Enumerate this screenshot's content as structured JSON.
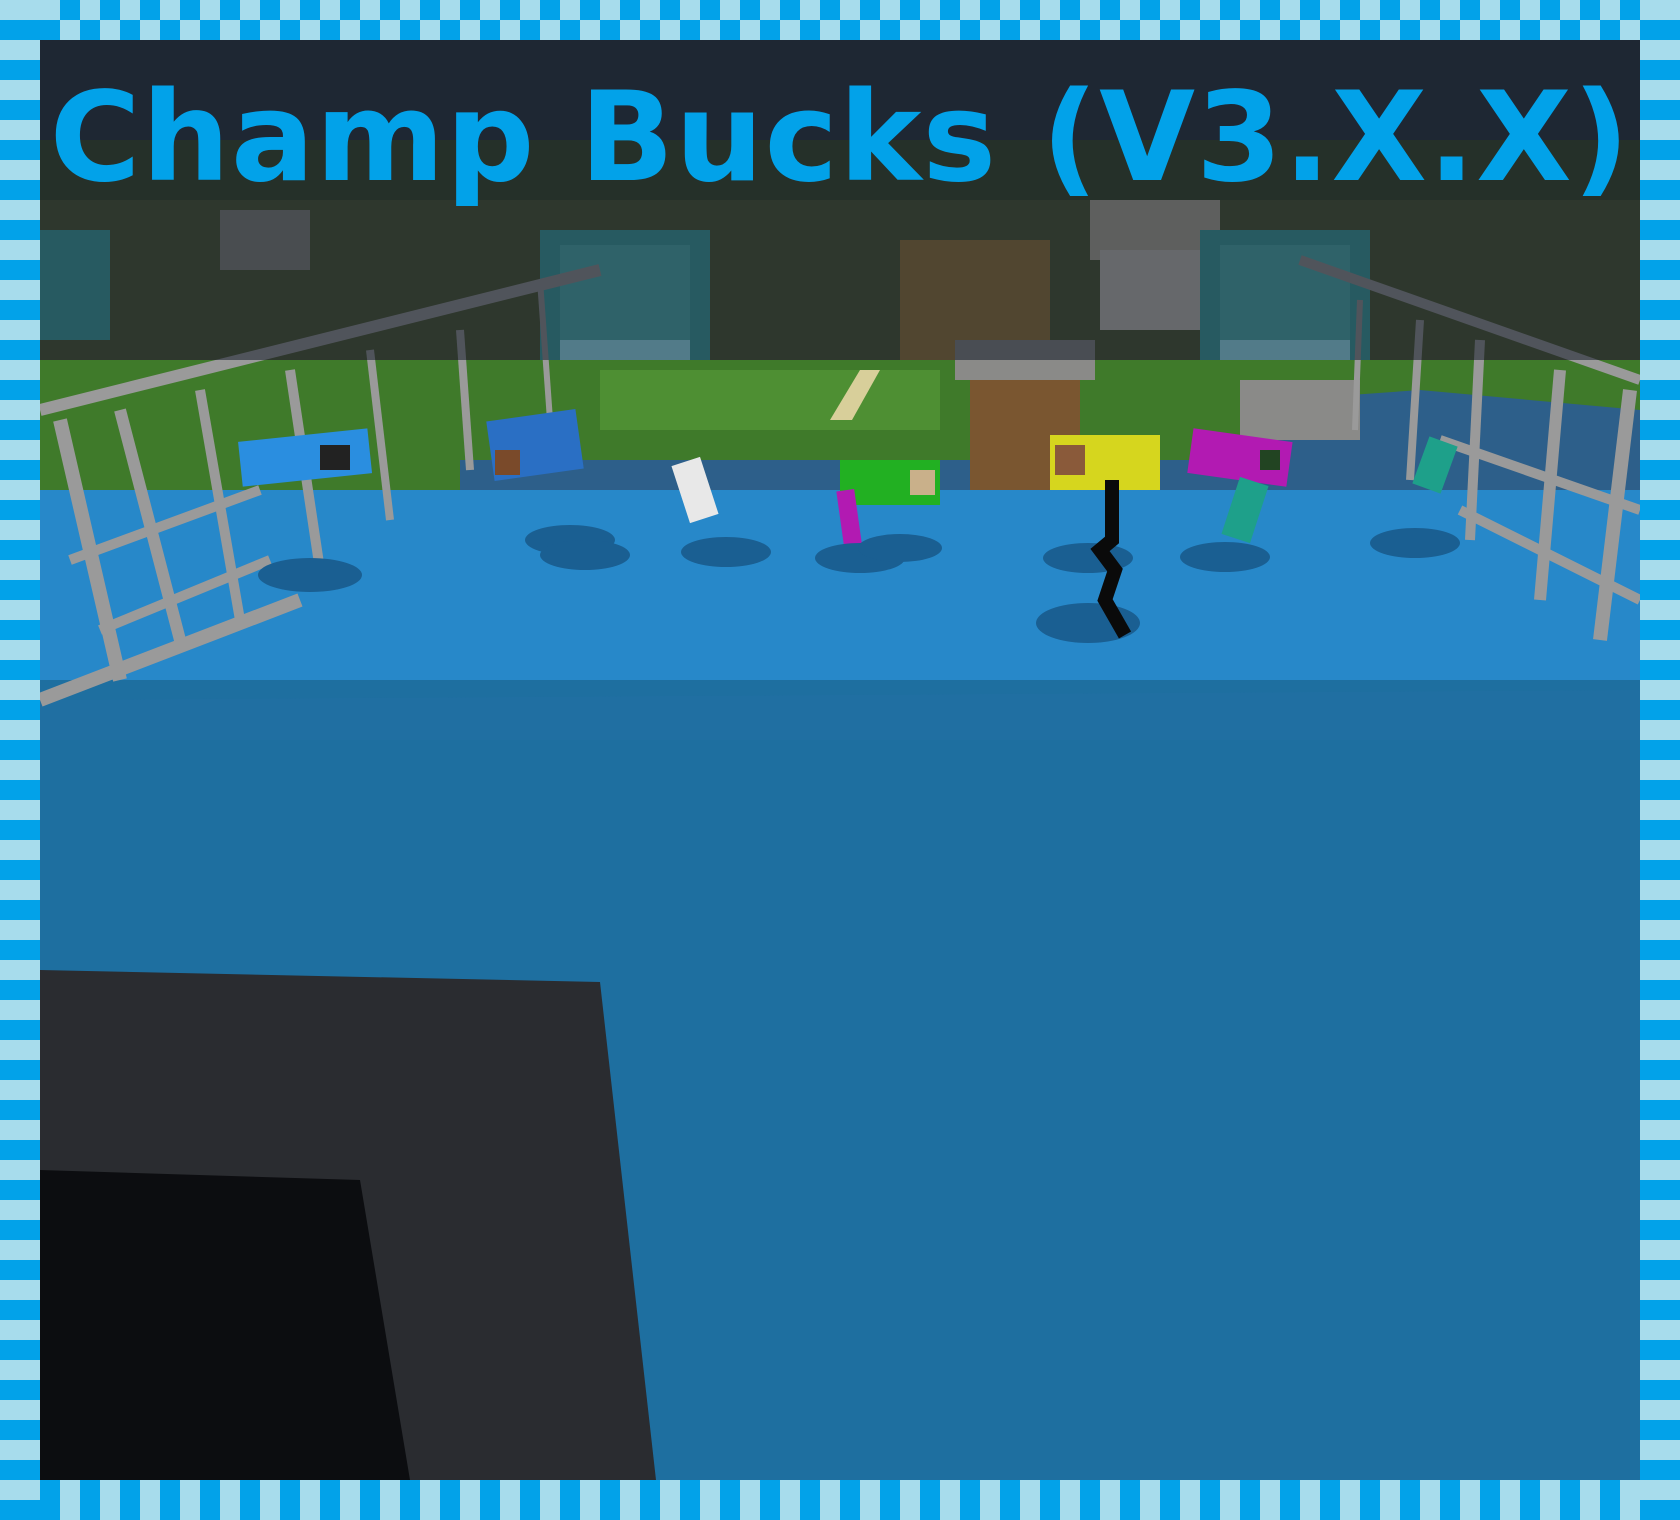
{
  "title": "Champ Bucks (V3.X.X)",
  "colors": {
    "frame_dark": "#02a2e9",
    "frame_light": "#a7dcec",
    "title_text": "#02a2e9",
    "floor_near": "#1e6fa0",
    "floor_far": "#2788c9"
  },
  "scene": {
    "description_items": [
      "glass-railing-left",
      "glass-railing-right",
      "beacon-block",
      "village-background",
      "player-banners",
      "pressure-plate-circles",
      "player-held-block"
    ],
    "banner_colors": [
      "#2a8ee0",
      "#2a6fc4",
      "#e8e8e8",
      "#22b022",
      "#d6d61e",
      "#b21ab2",
      "#1ea08a"
    ]
  }
}
